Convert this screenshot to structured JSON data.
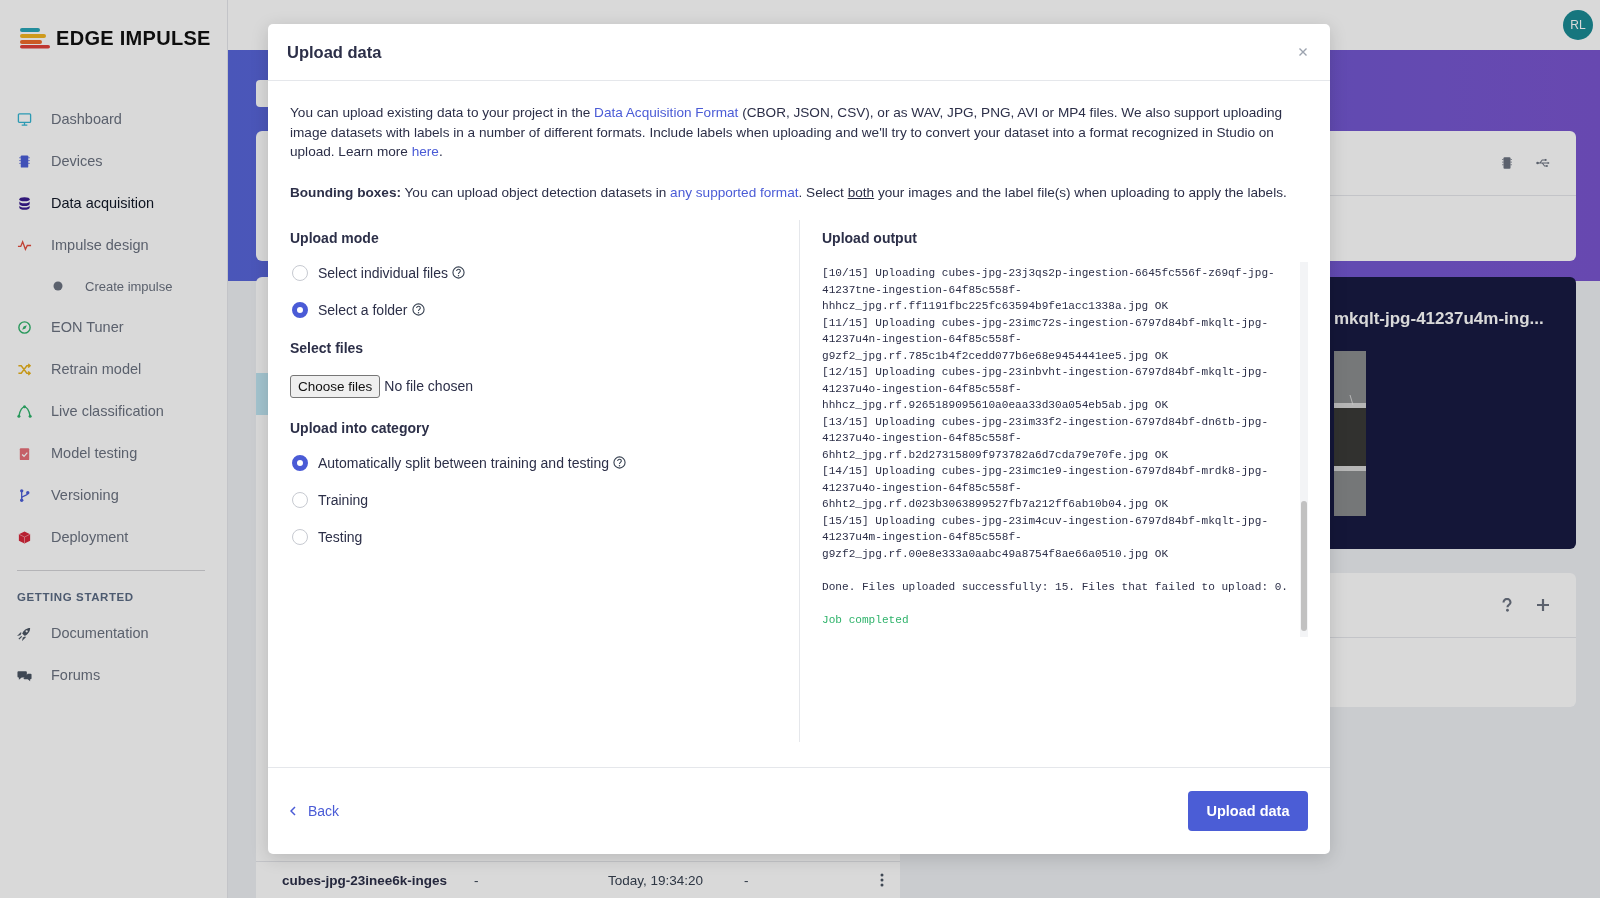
{
  "app": {
    "logo": "EDGE IMPULSE",
    "avatar": "RL"
  },
  "sidebar": {
    "items": [
      {
        "label": "Dashboard",
        "kind": "monitor",
        "selected": false
      },
      {
        "label": "Devices",
        "kind": "chip",
        "selected": false
      },
      {
        "label": "Data acquisition",
        "kind": "database",
        "selected": true
      },
      {
        "label": "Impulse design",
        "kind": "pulse",
        "selected": false,
        "children": [
          {
            "label": "Create impulse",
            "selected": false
          }
        ]
      },
      {
        "label": "EON Tuner",
        "kind": "compass",
        "selected": false
      },
      {
        "label": "Retrain model",
        "kind": "shuffle",
        "selected": false
      },
      {
        "label": "Live classification",
        "kind": "curve",
        "selected": false
      },
      {
        "label": "Model testing",
        "kind": "clipboard",
        "selected": false
      },
      {
        "label": "Versioning",
        "kind": "branch",
        "selected": false
      },
      {
        "label": "Deployment",
        "kind": "cube",
        "selected": false
      }
    ],
    "section": "GETTING STARTED",
    "links": [
      {
        "label": "Documentation",
        "kind": "rocket"
      },
      {
        "label": "Forums",
        "kind": "chat"
      }
    ]
  },
  "background": {
    "card_title": "mkqlt-jpg-41237u4m-ing...",
    "table_row": [
      "cubes-jpg-23inee6k-inges",
      "-",
      "Today, 19:34:20",
      "-"
    ]
  },
  "modal": {
    "title": "Upload data",
    "intro": [
      {
        "kind": "text",
        "text": "You can upload existing data to your project in the "
      },
      {
        "kind": "link",
        "text": "Data Acquisition Format"
      },
      {
        "kind": "text",
        "text": " (CBOR, JSON, CSV), or as WAV, JPG, PNG, AVI or MP4 files. We also support uploading image datasets with labels in a number of different formats. Include labels when uploading and we'll try to convert your dataset into a format recognized in Studio on upload. Learn more "
      },
      {
        "kind": "link",
        "text": "here"
      },
      {
        "kind": "text",
        "text": "."
      }
    ],
    "note": [
      {
        "kind": "text",
        "text": "**Bounding boxes:** You can upload object detection datasets in "
      },
      {
        "kind": "link",
        "text": "any supported format"
      },
      {
        "kind": "text",
        "text": ". Select "
      },
      {
        "kind": "underline",
        "text": "both"
      },
      {
        "kind": "text",
        "text": " your images and the label file(s) when uploading to apply the labels."
      }
    ],
    "upload_mode": {
      "heading": "Upload mode",
      "options": [
        {
          "label": "Select individual files",
          "selected": false,
          "help": true
        },
        {
          "label": "Select a folder",
          "selected": true,
          "help": true
        }
      ]
    },
    "select_files": {
      "heading": "Select files",
      "button": "Choose files",
      "status": "No file chosen"
    },
    "category": {
      "heading": "Upload into category",
      "options": [
        {
          "label": "Automatically split between training and testing",
          "selected": true,
          "help": true
        },
        {
          "label": "Training",
          "selected": false,
          "help": false
        },
        {
          "label": "Testing",
          "selected": false,
          "help": false
        }
      ]
    },
    "output": {
      "heading": "Upload output",
      "lines": [
        "[10/15] Uploading cubes-jpg-23j3qs2p-ingestion-6645fc556f-z69qf-jpg-",
        "41237tne-ingestion-64f85c558f-",
        "hhhcz_jpg.rf.ff1191fbc225fc63594b9fe1acc1338a.jpg OK",
        "[11/15] Uploading cubes-jpg-23imc72s-ingestion-6797d84bf-mkqlt-jpg-",
        "41237u4n-ingestion-64f85c558f-",
        "g9zf2_jpg.rf.785c1b4f2cedd077b6e68e9454441ee5.jpg OK",
        "[12/15] Uploading cubes-jpg-23inbvht-ingestion-6797d84bf-mkqlt-jpg-",
        "41237u4o-ingestion-64f85c558f-",
        "hhhcz_jpg.rf.9265189095610a0eaa33d30a054eb5ab.jpg OK",
        "[13/15] Uploading cubes-jpg-23im33f2-ingestion-6797d84bf-dn6tb-jpg-",
        "41237u4o-ingestion-64f85c558f-",
        "6hht2_jpg.rf.b2d27315809f973782a6d7cda79e70fe.jpg OK",
        "[14/15] Uploading cubes-jpg-23imc1e9-ingestion-6797d84bf-mrdk8-jpg-",
        "41237u4o-ingestion-64f85c558f-",
        "6hht2_jpg.rf.d023b3063899527fb7a212ff6ab10b04.jpg OK",
        "[15/15] Uploading cubes-jpg-23im4cuv-ingestion-6797d84bf-mkqlt-jpg-",
        "41237u4m-ingestion-64f85c558f-",
        "g9zf2_jpg.rf.00e8e333a0aabc49a8754f8ae66a0510.jpg OK"
      ],
      "summary": "Done. Files uploaded successfully: 15. Files that failed to upload: 0.",
      "status": "Job completed"
    },
    "footer": {
      "back": "Back",
      "submit": "Upload data"
    }
  }
}
